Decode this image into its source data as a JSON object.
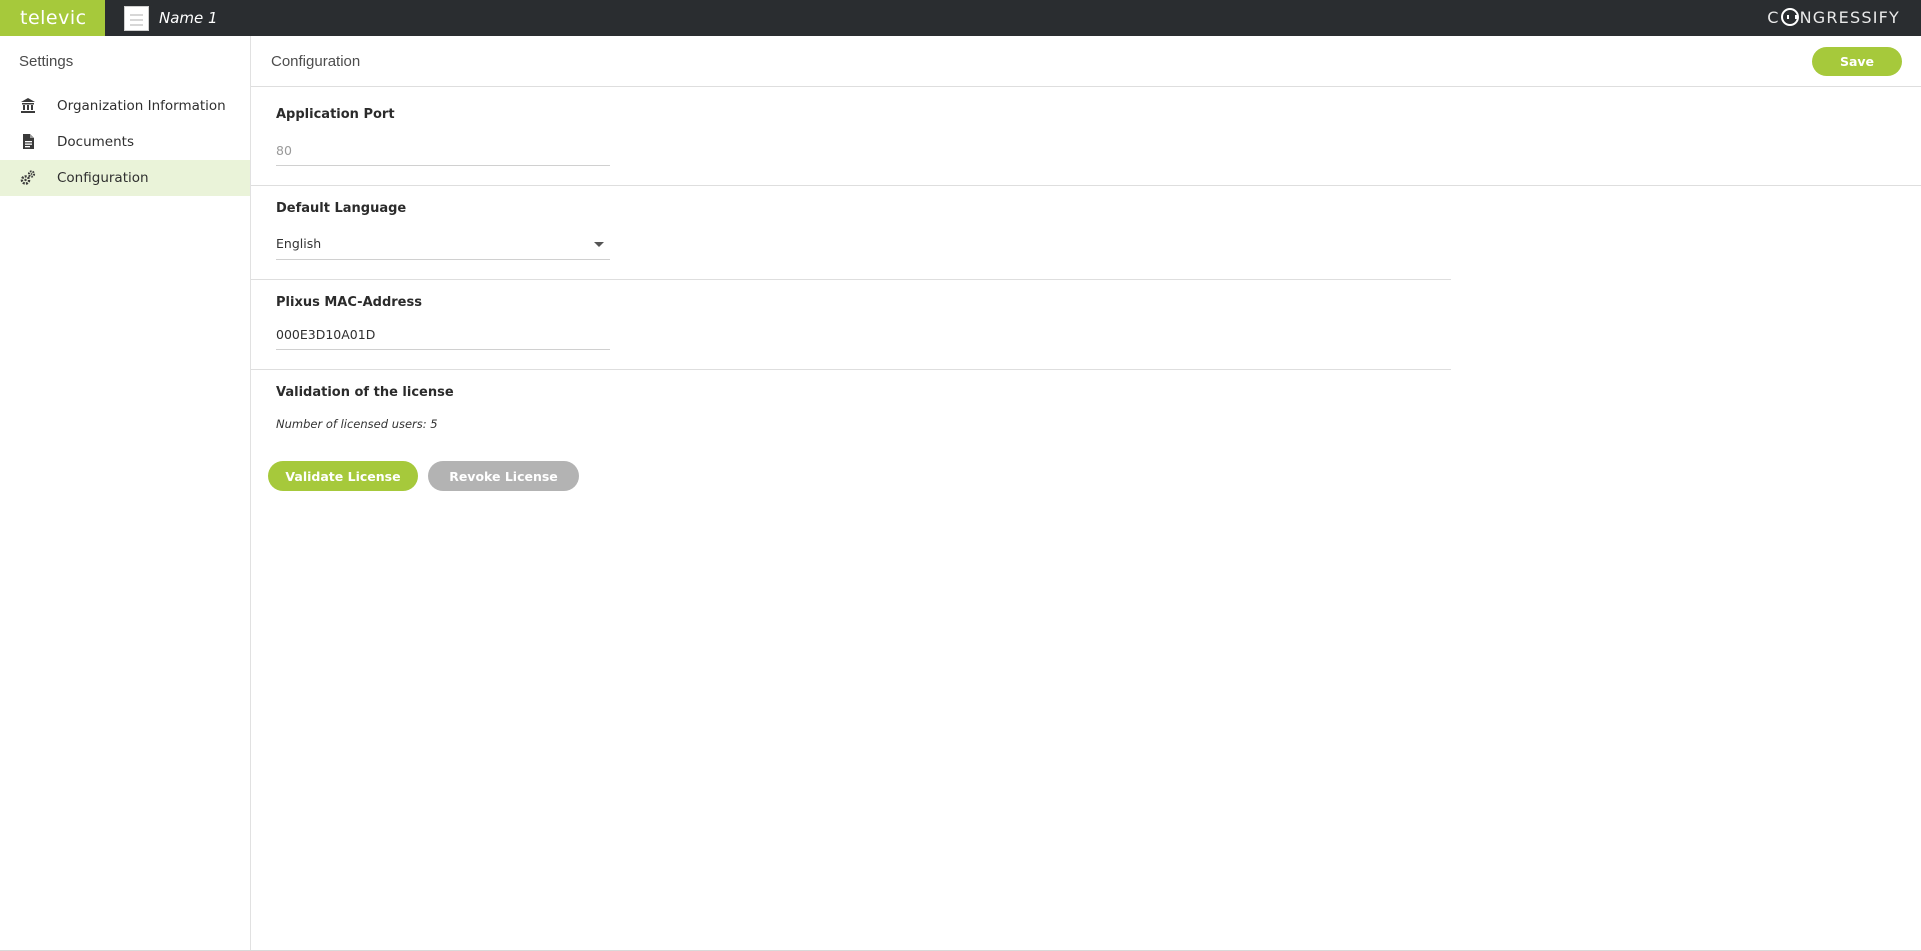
{
  "topbar": {
    "brand": "televic",
    "document_name": "Name 1",
    "product_name_before": "C",
    "product_name_after": "NGRESSIFY"
  },
  "sidebar": {
    "title": "Settings",
    "items": [
      {
        "label": "Organization Information",
        "icon": "bank-icon",
        "active": false
      },
      {
        "label": "Documents",
        "icon": "document-icon",
        "active": false
      },
      {
        "label": "Configuration",
        "icon": "gears-icon",
        "active": true
      }
    ]
  },
  "main": {
    "title": "Configuration",
    "save_label": "Save",
    "application_port": {
      "label": "Application Port",
      "value": "80"
    },
    "default_language": {
      "label": "Default Language",
      "selected": "English"
    },
    "mac_address": {
      "label": "Plixus MAC-Address",
      "value": "000E3D10A01D"
    },
    "license": {
      "label": "Validation of the license",
      "licensed_users_text": "Number of licensed users: 5",
      "validate_label": "Validate License",
      "revoke_label": "Revoke License"
    }
  },
  "colors": {
    "accent": "#a6c93b",
    "topbar": "#2a2d30",
    "active_nav": "#eaf3d9",
    "disabled_button": "#b3b3b3"
  }
}
